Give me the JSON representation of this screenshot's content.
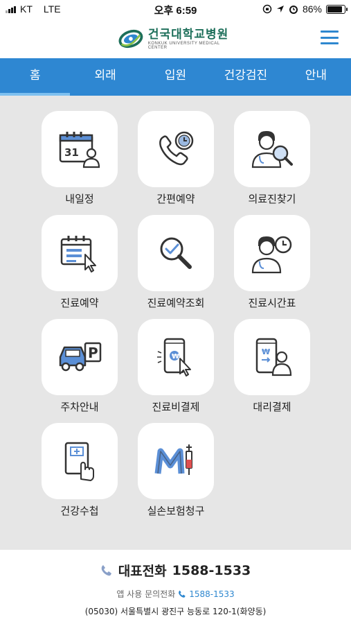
{
  "status_bar": {
    "carrier": "KT",
    "network": "LTE",
    "time": "오후 6:59",
    "battery": "86%",
    "battery_level": 0.86
  },
  "header": {
    "logo_kr": "건국대학교병원",
    "logo_en": "KONKUK UNIVERSITY MEDICAL CENTER",
    "brand_colors": {
      "green": "#1d6f5a",
      "blue": "#2e87cf"
    }
  },
  "tabs": [
    {
      "label": "홈",
      "active": true
    },
    {
      "label": "외래"
    },
    {
      "label": "입원"
    },
    {
      "label": "건강검진"
    },
    {
      "label": "안내"
    }
  ],
  "menu": [
    {
      "label": "내일정",
      "icon": "calendar-person-icon"
    },
    {
      "label": "간편예약",
      "icon": "phone-clock-icon"
    },
    {
      "label": "의료진찾기",
      "icon": "doctor-search-icon"
    },
    {
      "label": "진료예약",
      "icon": "calendar-cursor-icon"
    },
    {
      "label": "진료예약조회",
      "icon": "magnifier-check-icon"
    },
    {
      "label": "진료시간표",
      "icon": "doctor-clock-icon"
    },
    {
      "label": "주차안내",
      "icon": "car-parking-icon"
    },
    {
      "label": "진료비결제",
      "icon": "mobile-payment-icon"
    },
    {
      "label": "대리결제",
      "icon": "mobile-proxy-payment-icon"
    },
    {
      "label": "건강수첩",
      "icon": "tablet-hand-icon"
    },
    {
      "label": "실손보험청구",
      "icon": "insurance-claim-icon"
    }
  ],
  "calendar_day": "31",
  "parking_letter": "P",
  "footer": {
    "main_label": "대표전화",
    "main_number": "1588-1533",
    "sub_label": "앱 사용 문의전화",
    "sub_number": "1588-1533",
    "address": "(05030) 서울특별시 광진구 능동로 120-1(화양동)"
  }
}
